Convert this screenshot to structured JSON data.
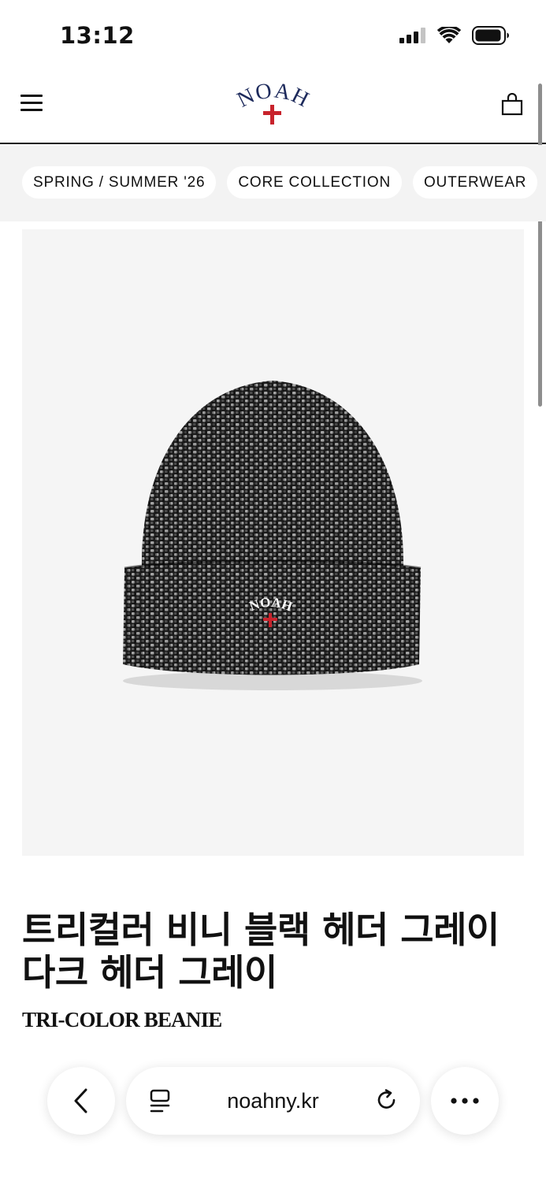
{
  "status_bar": {
    "time": "13:12"
  },
  "header": {
    "logo_text": "NOAH"
  },
  "categories": [
    "SPRING / SUMMER '26",
    "CORE COLLECTION",
    "OUTERWEAR"
  ],
  "product": {
    "image_alt": "Tri-color beanie",
    "logo_text": "NOAH",
    "title_ko": "트리컬러 비니 블랙 헤더 그레이 다크 헤더 그레이",
    "title_en": "TRI-COLOR BEANIE"
  },
  "browser": {
    "url": "noahny.kr"
  },
  "colors": {
    "logo_navy": "#1d2a5c",
    "logo_red": "#c8232c",
    "strip_bg": "#f3f3f3"
  }
}
